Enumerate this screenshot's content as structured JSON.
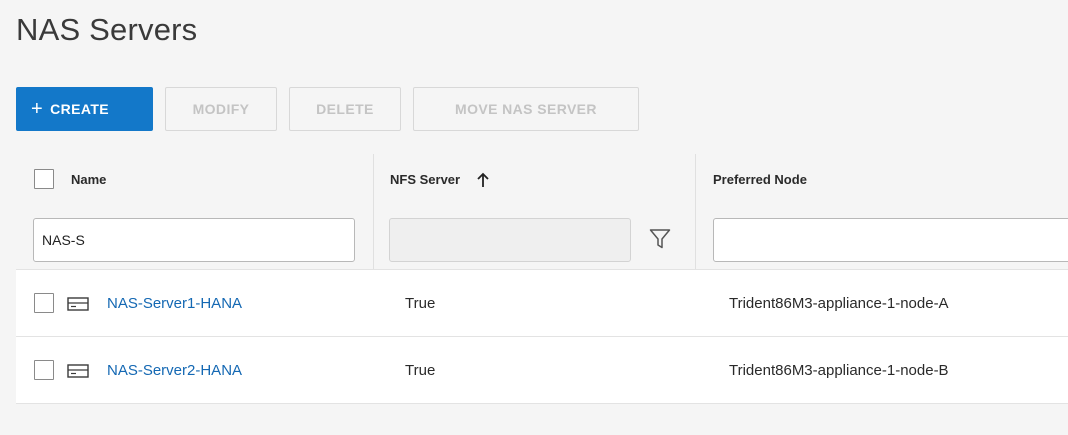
{
  "page": {
    "title": "NAS Servers"
  },
  "toolbar": {
    "create_label": "CREATE",
    "create_icon": "plus-icon",
    "modify_label": "MODIFY",
    "delete_label": "DELETE",
    "move_label": "MOVE NAS SERVER"
  },
  "table": {
    "columns": [
      {
        "label": "Name"
      },
      {
        "label": "NFS Server",
        "sort": "ascending"
      },
      {
        "label": "Preferred Node"
      }
    ],
    "filters": {
      "name_value": "NAS-S",
      "nfs_value": "",
      "node_value": ""
    },
    "rows": [
      {
        "name": "NAS-Server1-HANA",
        "nfs": "True",
        "node": "Trident86M3-appliance-1-node-A"
      },
      {
        "name": "NAS-Server2-HANA",
        "nfs": "True",
        "node": "Trident86M3-appliance-1-node-B"
      }
    ]
  },
  "colors": {
    "accent": "#1378c9",
    "link": "#1468b3"
  }
}
